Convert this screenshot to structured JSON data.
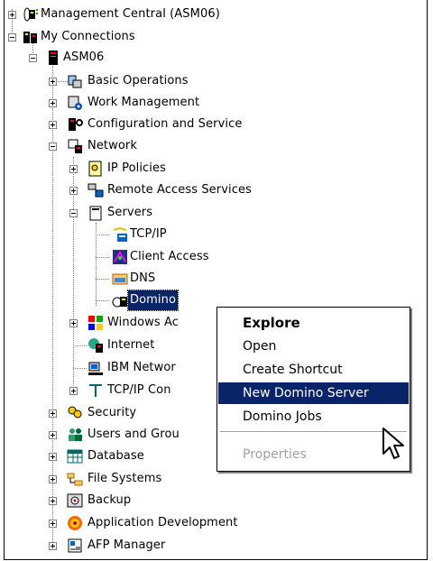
{
  "tree": {
    "items": [
      {
        "label": "Management Central (ASM06)",
        "icon": "management-central-icon",
        "expander": "plus"
      },
      {
        "label": "My Connections",
        "icon": "connections-icon",
        "expander": "minus"
      },
      {
        "label": "ASM06",
        "icon": "system-icon",
        "expander": "minus"
      },
      {
        "label": "Basic Operations",
        "icon": "basic-operations-icon",
        "expander": "plus"
      },
      {
        "label": "Work Management",
        "icon": "work-management-icon",
        "expander": "plus"
      },
      {
        "label": "Configuration and Service",
        "icon": "configuration-icon",
        "expander": "plus"
      },
      {
        "label": "Network",
        "icon": "network-icon",
        "expander": "minus"
      },
      {
        "label": "IP Policies",
        "icon": "ip-policies-icon",
        "expander": "plus"
      },
      {
        "label": "Remote Access Services",
        "icon": "remote-access-icon",
        "expander": "plus"
      },
      {
        "label": "Servers",
        "icon": "servers-icon",
        "expander": "minus"
      },
      {
        "label": "TCP/IP",
        "icon": "tcpip-icon",
        "expander": "none"
      },
      {
        "label": "Client Access",
        "icon": "client-access-icon",
        "expander": "none"
      },
      {
        "label": "DNS",
        "icon": "dns-icon",
        "expander": "none"
      },
      {
        "label": "Domino",
        "icon": "domino-icon",
        "expander": "none"
      },
      {
        "label": "Windows Ac",
        "icon": "windows-icon",
        "expander": "plus"
      },
      {
        "label": "Internet",
        "icon": "internet-icon",
        "expander": "none"
      },
      {
        "label": "IBM Networ",
        "icon": "ibm-network-icon",
        "expander": "none"
      },
      {
        "label": "TCP/IP Con",
        "icon": "tcpip-connectivity-icon",
        "expander": "plus"
      },
      {
        "label": "Security",
        "icon": "security-icon",
        "expander": "plus"
      },
      {
        "label": "Users and Grou",
        "icon": "users-groups-icon",
        "expander": "plus"
      },
      {
        "label": "Database",
        "icon": "database-icon",
        "expander": "plus"
      },
      {
        "label": "File Systems",
        "icon": "file-systems-icon",
        "expander": "plus"
      },
      {
        "label": "Backup",
        "icon": "backup-icon",
        "expander": "plus"
      },
      {
        "label": "Application Development",
        "icon": "app-development-icon",
        "expander": "plus"
      },
      {
        "label": "AFP Manager",
        "icon": "afp-manager-icon",
        "expander": "plus"
      }
    ],
    "selected": "Domino"
  },
  "context_menu": {
    "items": [
      {
        "label": "Explore",
        "style": "default"
      },
      {
        "label": "Open",
        "style": "normal"
      },
      {
        "label": "Create Shortcut",
        "style": "normal"
      },
      {
        "label": "New Domino Server",
        "style": "highlighted"
      },
      {
        "label": "Domino Jobs",
        "style": "normal"
      },
      {
        "label": "Properties",
        "style": "disabled"
      }
    ]
  },
  "colors": {
    "highlight": "#0a246a",
    "disabled": "#a0a0a0",
    "tree_lines": "#808080"
  }
}
